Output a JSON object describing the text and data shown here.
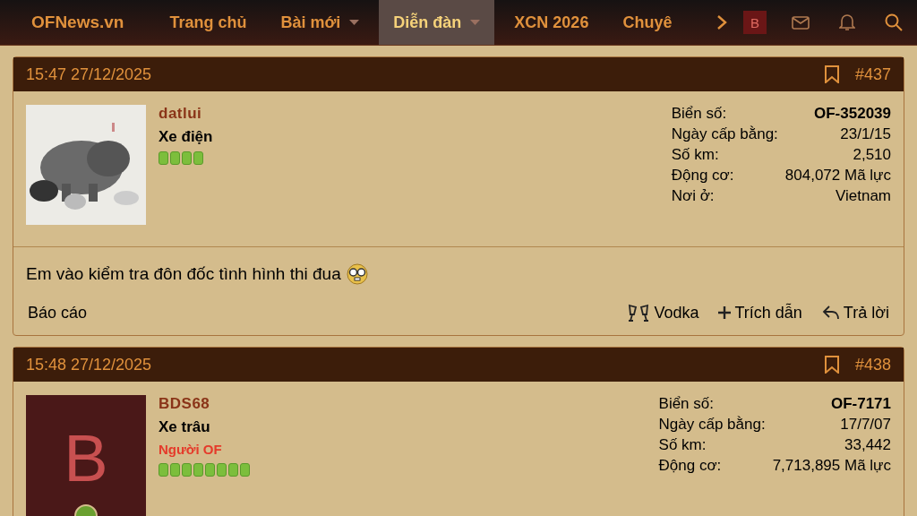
{
  "nav": {
    "brand": "OFNews.vn",
    "items": [
      {
        "label": "Trang chủ",
        "dropdown": false,
        "selected": false
      },
      {
        "label": "Bài mới",
        "dropdown": true,
        "selected": false
      },
      {
        "label": "Diễn đàn",
        "dropdown": true,
        "selected": true
      },
      {
        "label": "XCN 2026",
        "dropdown": false,
        "selected": false
      },
      {
        "label": "Chuyê",
        "dropdown": false,
        "selected": false
      }
    ],
    "user_avatar": "B"
  },
  "posts": [
    {
      "time": "15:47 27/12/2025",
      "number": "#437",
      "username": "datlui",
      "user_title": "Xe điện",
      "stars": 4,
      "stats": [
        {
          "label": "Biển số:",
          "value": "OF-352039",
          "bold": true
        },
        {
          "label": "Ngày cấp bằng:",
          "value": "23/1/15",
          "bold": false
        },
        {
          "label": "Số km:",
          "value": "2,510",
          "bold": false
        },
        {
          "label": "Động cơ:",
          "value": "804,072 Mã lực",
          "bold": false
        },
        {
          "label": "Nơi ở:",
          "value": "Vietnam",
          "bold": false
        }
      ],
      "message": "Em vào kiểm tra đôn đốc tình hình thi đua",
      "actions": {
        "report": "Báo cáo",
        "reactions": [
          {
            "kind": "cheers",
            "label": "Vodka"
          },
          {
            "kind": "quote",
            "label": "Trích dẫn"
          },
          {
            "kind": "reply",
            "label": "Trả lời"
          }
        ]
      }
    },
    {
      "time": "15:48 27/12/2025",
      "number": "#438",
      "avatar": {
        "kind": "letter",
        "letter": "B"
      },
      "username": "BDS68",
      "user_title": "Xe trâu",
      "banner": "Người OF",
      "stars": 8,
      "stats": [
        {
          "label": "Biển số:",
          "value": "OF-7171",
          "bold": true
        },
        {
          "label": "Ngày cấp bằng:",
          "value": "17/7/07",
          "bold": false
        },
        {
          "label": "Số km:",
          "value": "33,442",
          "bold": false
        },
        {
          "label": "Động cơ:",
          "value": "7,713,895 Mã lực",
          "bold": false
        }
      ]
    }
  ]
}
